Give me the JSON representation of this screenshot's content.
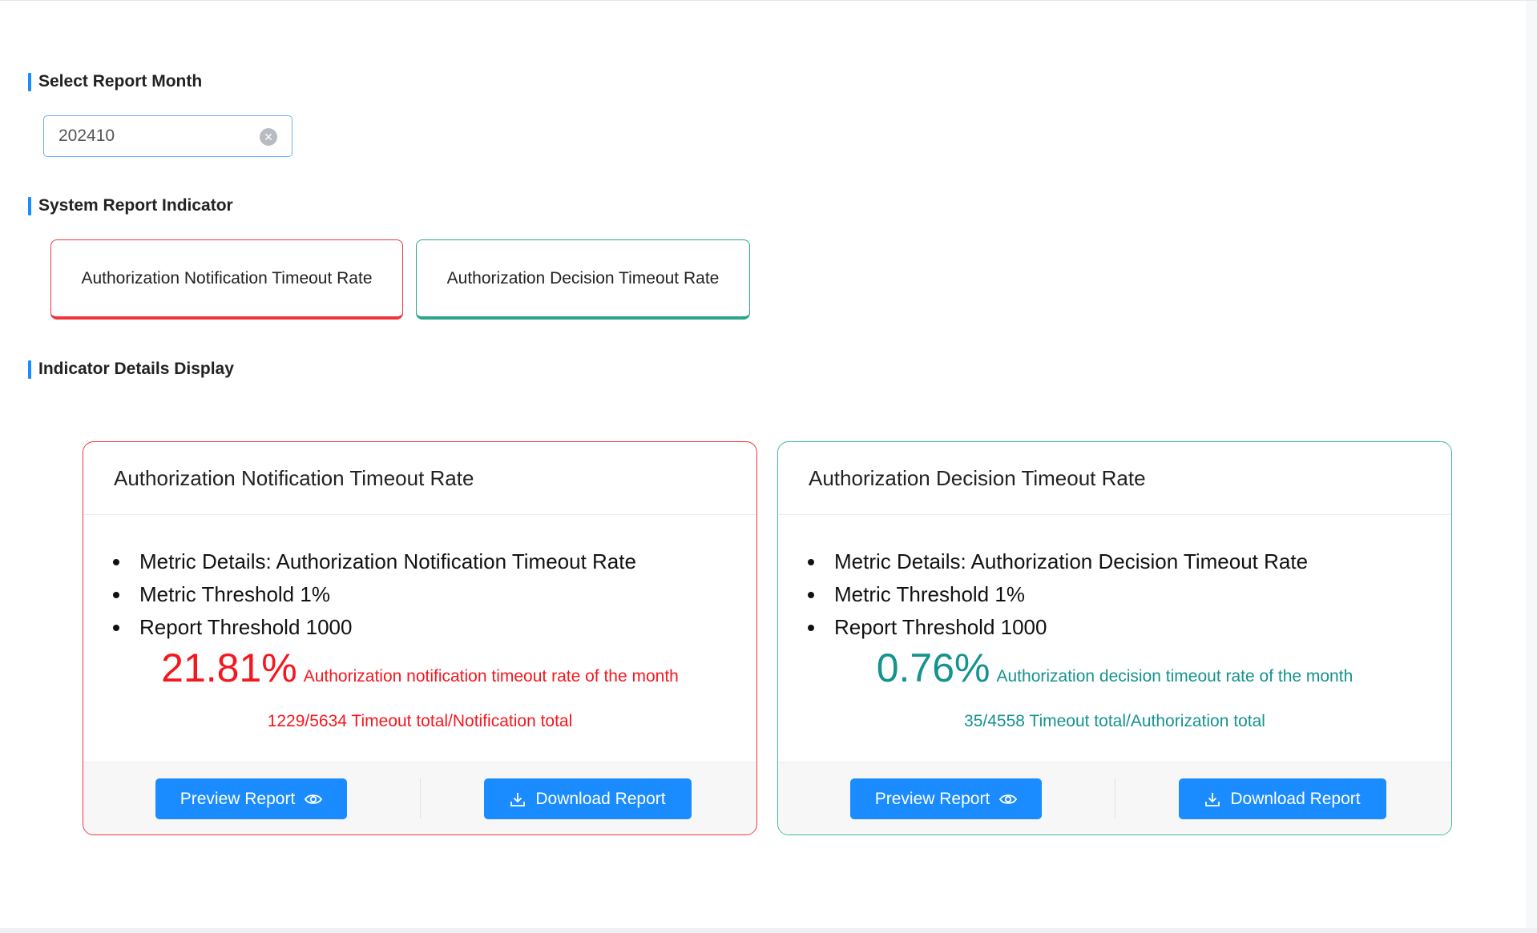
{
  "sections": {
    "select_month": "Select Report Month",
    "system_indicator": "System Report Indicator",
    "details_display": "Indicator Details Display"
  },
  "month_input": {
    "value": "202410",
    "clear_icon": "close-circle-icon"
  },
  "indicator_buttons": [
    {
      "label": "Authorization Notification Timeout Rate",
      "accent": "#f0343c"
    },
    {
      "label": "Authorization Decision Timeout Rate",
      "accent": "#2aa58a"
    }
  ],
  "cards": [
    {
      "title": "Authorization Notification Timeout Rate",
      "details": [
        "Metric Details: Authorization Notification Timeout Rate",
        "Metric Threshold 1%",
        "Report Threshold 1000"
      ],
      "rate": "21.81%",
      "rate_desc": "Authorization notification timeout rate of the month",
      "ratio": "1229/5634 Timeout total/Notification total",
      "preview_label": "Preview Report",
      "download_label": "Download Report",
      "color": "#f5171f"
    },
    {
      "title": "Authorization Decision Timeout Rate",
      "details": [
        "Metric Details: Authorization Decision Timeout Rate",
        "Metric Threshold 1%",
        "Report Threshold 1000"
      ],
      "rate": "0.76%",
      "rate_desc": "Authorization decision timeout rate of the month",
      "ratio": "35/4558 Timeout total/Authorization total",
      "preview_label": "Preview Report",
      "download_label": "Download Report",
      "color": "#14938f"
    }
  ],
  "icons": {
    "preview": "eye-icon",
    "download": "download-icon"
  },
  "colors": {
    "primary": "#1a8cff",
    "danger": "#f0343c",
    "success": "#2aa58a"
  }
}
